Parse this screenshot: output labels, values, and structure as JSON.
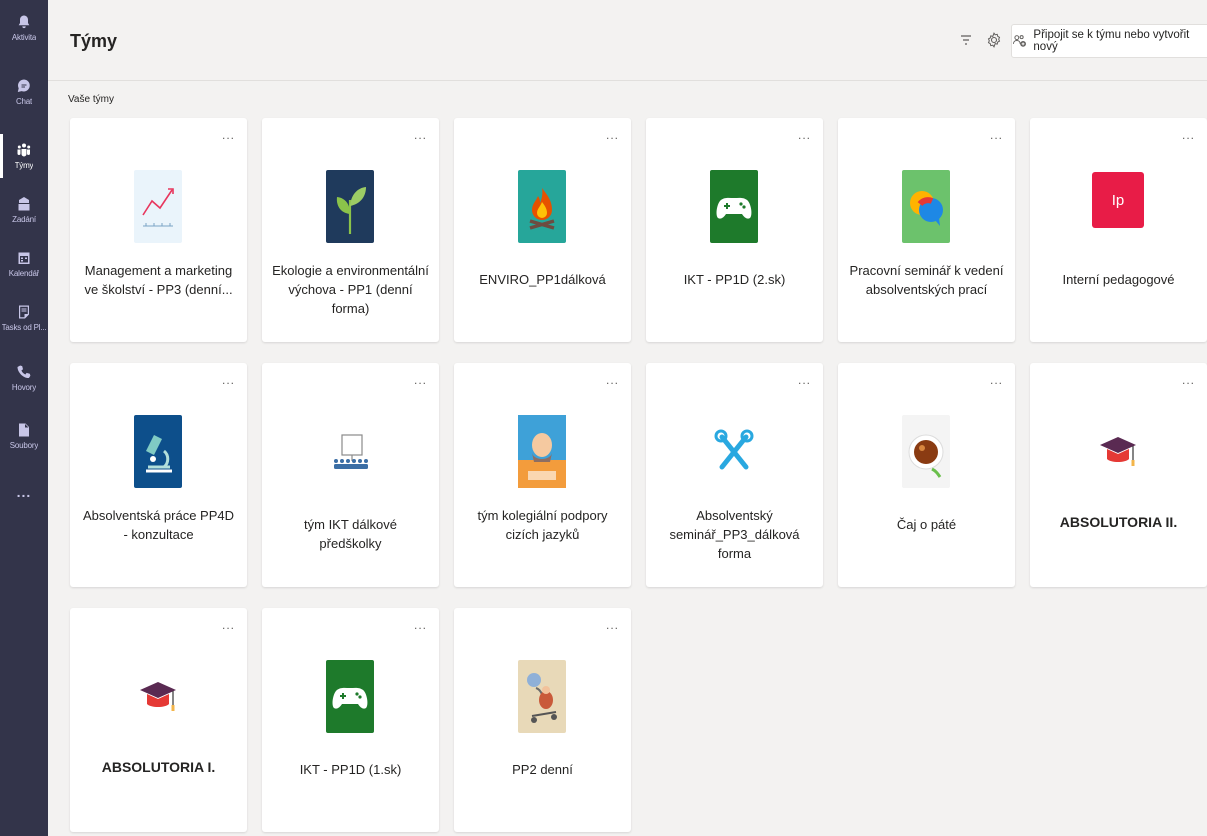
{
  "rail": {
    "items": [
      {
        "label": "Aktivita",
        "icon": "bell-icon"
      },
      {
        "label": "Chat",
        "icon": "chat-icon"
      },
      {
        "label": "Týmy",
        "icon": "teams-icon",
        "active": true
      },
      {
        "label": "Zadání",
        "icon": "assignments-icon"
      },
      {
        "label": "Kalendář",
        "icon": "calendar-icon"
      },
      {
        "label": "Tasks od Pl...",
        "icon": "tasks-icon"
      },
      {
        "label": "Hovory",
        "icon": "phone-icon"
      },
      {
        "label": "Soubory",
        "icon": "file-icon"
      }
    ],
    "more": "..."
  },
  "header": {
    "title": "Týmy",
    "join_button": "Připojit se k týmu nebo vytvořit nový"
  },
  "section_title": "Vaše týmy",
  "more_glyph": "...",
  "teams": [
    {
      "name": "Management a marketing ve školství - PP3 (denní...",
      "icon": "chart-trend-icon"
    },
    {
      "name": "Ekologie a environmentální výchova - PP1 (denní forma)",
      "icon": "plant-icon"
    },
    {
      "name": "ENVIRO_PP1dálková",
      "icon": "campfire-icon"
    },
    {
      "name": "IKT - PP1D (2.sk)",
      "icon": "gamepad-icon"
    },
    {
      "name": "Pracovní seminář k vedení absolventských prací",
      "icon": "speech-bubbles-icon"
    },
    {
      "name": "Interní pedagogové",
      "icon": "initials-avatar",
      "initials": "Ip"
    },
    {
      "name": "Absolventská práce PP4D - konzultace",
      "icon": "microscope-icon"
    },
    {
      "name": "tým IKT dálkové předškolky",
      "icon": "presentation-icon"
    },
    {
      "name": "tým kolegiální podpory cizích jazyků",
      "icon": "portrait-icon"
    },
    {
      "name": "Absolventský seminář_PP3_dálková forma",
      "icon": "tools-icon"
    },
    {
      "name": "Čaj o páté",
      "icon": "tea-cup-icon"
    },
    {
      "name": "ABSOLUTORIA II.",
      "icon": "graduation-cap-icon"
    },
    {
      "name": "ABSOLUTORIA I.",
      "icon": "graduation-cap-icon"
    },
    {
      "name": "IKT - PP1D (1.sk)",
      "icon": "gamepad-icon"
    },
    {
      "name": "PP2 denní",
      "icon": "cartoon-icon"
    }
  ]
}
